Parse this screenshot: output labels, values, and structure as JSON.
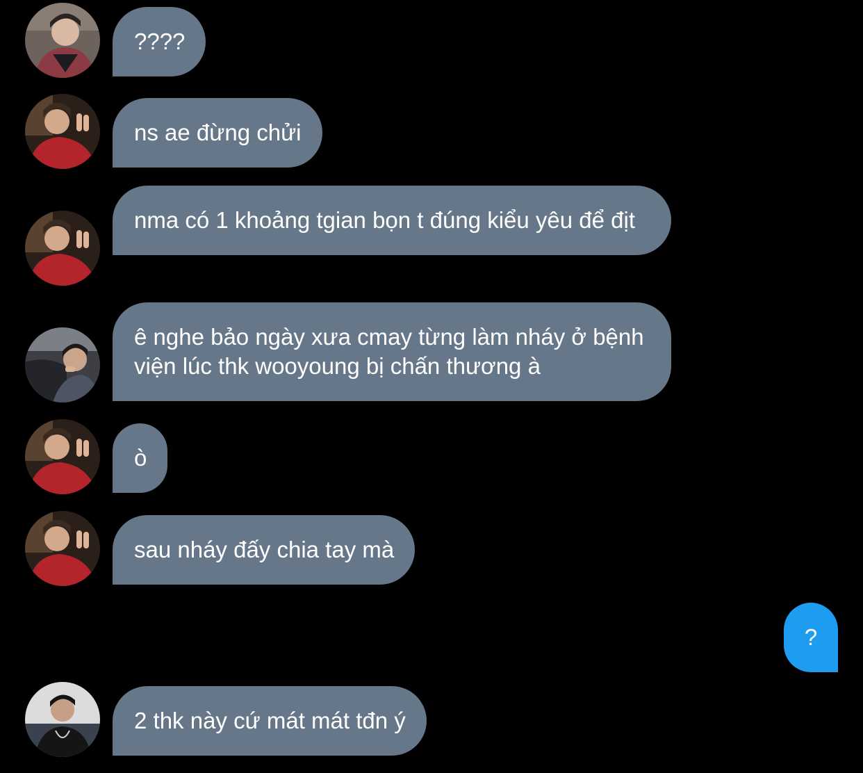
{
  "conversation": {
    "messages": [
      {
        "sender": "incoming",
        "avatar": "avatar-user-a",
        "text": "????"
      },
      {
        "sender": "incoming",
        "avatar": "avatar-user-b",
        "text": "ns ae đừng chửi"
      },
      {
        "sender": "incoming",
        "avatar": "avatar-user-b",
        "text": "nma có 1 khoảng tgian bọn t đúng kiểu yêu để địt"
      },
      {
        "sender": "incoming",
        "avatar": "avatar-user-c",
        "text": "ê nghe bảo ngày xưa cmay từng làm nháy ở bệnh viện lúc thk wooyoung bị chấn thương à"
      },
      {
        "sender": "incoming",
        "avatar": "avatar-user-b",
        "text": "ò"
      },
      {
        "sender": "incoming",
        "avatar": "avatar-user-b",
        "text": "sau nháy đấy chia tay mà"
      },
      {
        "sender": "outgoing",
        "text": "?"
      },
      {
        "sender": "incoming",
        "avatar": "avatar-user-d",
        "text": "2 thk này cứ mát mát tđn ý"
      }
    ]
  },
  "colors": {
    "background": "#000000",
    "incoming_bubble": "#66778a",
    "outgoing_bubble": "#1e9cf0",
    "text": "#ffffff"
  }
}
